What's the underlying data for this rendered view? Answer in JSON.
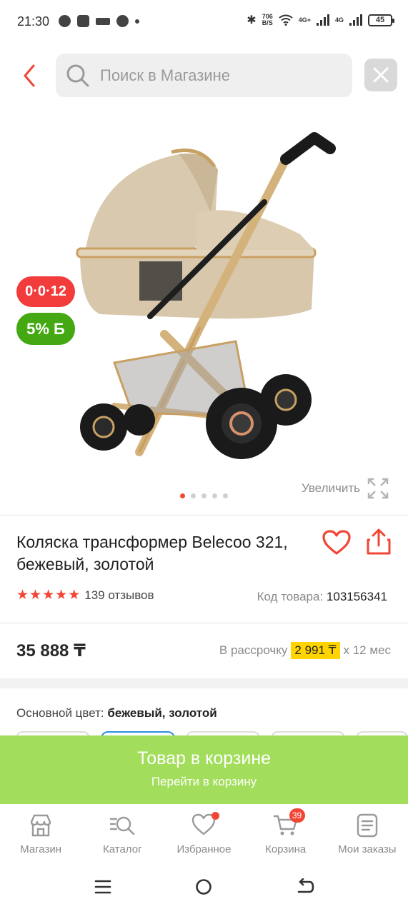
{
  "status_bar": {
    "time": "21:30",
    "net_speed_value": "706",
    "net_speed_unit": "B/S",
    "network_1": "4G+",
    "network_2": "4G",
    "battery": "45"
  },
  "search": {
    "placeholder": "Поиск в Магазине"
  },
  "product": {
    "badge_installment": "0·0·12",
    "badge_bonus": "5% Б",
    "zoom_label": "Увеличить",
    "image_count": 5,
    "active_image_index": 0,
    "title": "Коляска трансформер Belecoo 321, бежевый, золотой",
    "rating": 5,
    "reviews": "139 отзывов",
    "sku_label": "Код товара:",
    "sku_value": "103156341",
    "price": "35 888 ₸",
    "installment_prefix": "В рассрочку",
    "installment_amount": "2 991 ₸",
    "installment_suffix": "x 12 мес",
    "color_label": "Основной цвет:",
    "color_value": "бежевый, золотой"
  },
  "cart_banner": {
    "title": "Товар в корзине",
    "subtitle": "Перейти в корзину"
  },
  "bottom_nav": {
    "items": [
      {
        "label": "Магазин",
        "icon": "store-icon"
      },
      {
        "label": "Каталог",
        "icon": "catalog-search-icon"
      },
      {
        "label": "Избранное",
        "icon": "heart-icon"
      },
      {
        "label": "Корзина",
        "icon": "cart-icon"
      },
      {
        "label": "Мои заказы",
        "icon": "orders-icon"
      }
    ],
    "cart_count": "39"
  },
  "colors": {
    "accent_red": "#f14635",
    "installment_badge": "#f23b3b",
    "bonus_badge": "#43a811",
    "cart_banner": "#a2dd5b",
    "highlight": "#ffd400",
    "selected_chip": "#2d8fe0"
  }
}
